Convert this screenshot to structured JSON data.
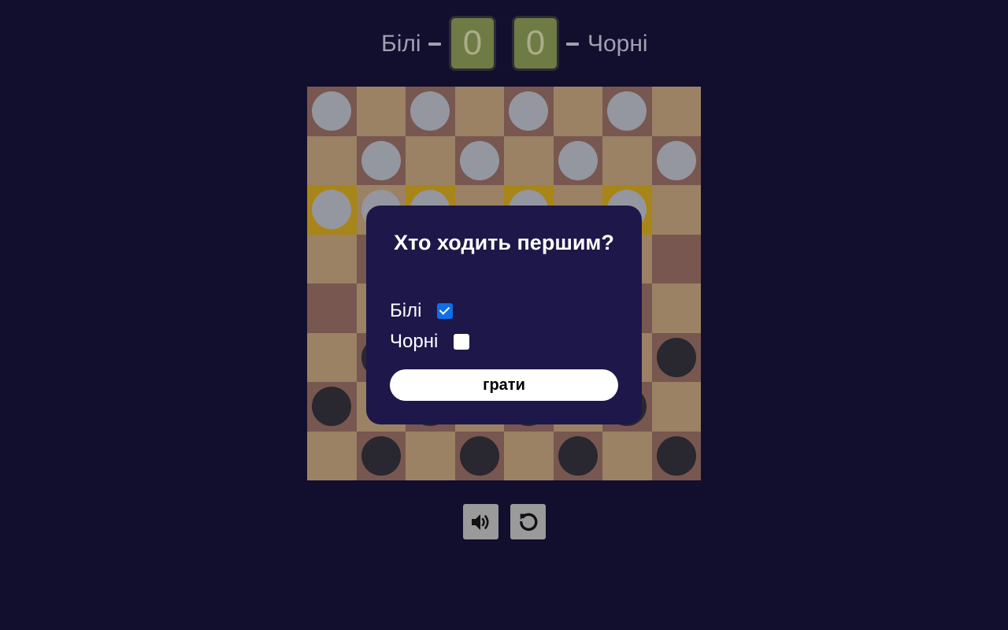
{
  "score": {
    "white_label": "Білі",
    "black_label": "Чорні",
    "white_score": "0",
    "black_score": "0"
  },
  "board": {
    "size": 8,
    "rows": [
      [
        "w",
        "",
        "w",
        "",
        "w",
        "",
        "w",
        ""
      ],
      [
        "",
        "w",
        "",
        "w",
        "",
        "w",
        "",
        "w"
      ],
      [
        "w",
        "w",
        "w",
        "",
        "w",
        "",
        "w",
        ""
      ],
      [
        "",
        "",
        "",
        "",
        "",
        "",
        "",
        ""
      ],
      [
        "",
        "",
        "",
        "",
        "",
        "",
        "",
        ""
      ],
      [
        "",
        "b",
        "",
        "",
        "",
        "",
        "",
        "b"
      ],
      [
        "b",
        "",
        "b",
        "",
        "b",
        "",
        "b",
        ""
      ],
      [
        "",
        "b",
        "",
        "b",
        "",
        "b",
        "",
        "b"
      ]
    ],
    "highlighted_row": 2,
    "highlighted_cols": [
      0,
      2,
      4,
      6
    ],
    "colors": {
      "light": "#9b8264",
      "dark": "#77574f",
      "highlight": "#a88519",
      "white_piece": "#9496a0",
      "black_piece": "#29272f"
    }
  },
  "modal": {
    "title": "Хто ходить першим?",
    "options": [
      {
        "label": "Білі",
        "checked": true
      },
      {
        "label": "Чорні",
        "checked": false
      }
    ],
    "play_button": "грати"
  },
  "controls": {
    "sound_icon": "speaker-icon",
    "restart_icon": "restart-icon"
  }
}
